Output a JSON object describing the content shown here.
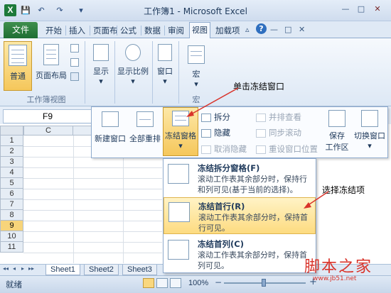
{
  "window": {
    "title": "工作簿1 - Microsoft Excel",
    "app_icon": "X",
    "minimize": "—",
    "restore": "□",
    "close": "✕",
    "ribbon_minimize": "▵",
    "help": "?",
    "doc_minimize": "—",
    "doc_restore": "□",
    "doc_close": "✕"
  },
  "quick_access": {
    "save": "💾",
    "undo": "↶",
    "redo": "↷",
    "customize": "▾"
  },
  "tabs": [
    "文件",
    "开始",
    "插入",
    "页面布",
    "公式",
    "数据",
    "审阅",
    "视图",
    "加载项"
  ],
  "active_tab": "视图",
  "ribbon": {
    "workbook_views_group": {
      "label": "工作簿视图",
      "normal": "普通",
      "page_layout": "页面布局"
    },
    "show_label": "显示",
    "zoom_label": "显示比例",
    "window_label": "窗口",
    "macros_label": "宏",
    "macros_group_label": "宏"
  },
  "formula_bar": {
    "name_box": "F9"
  },
  "grid": {
    "column_header": "C",
    "rows": [
      "1",
      "2",
      "3",
      "4",
      "5",
      "6",
      "7",
      "8",
      "9",
      "10",
      "11"
    ],
    "selected_row": "9"
  },
  "window_panel": {
    "new_window": "新建窗口",
    "arrange_all": "全部重排",
    "freeze_panes": "冻结窗格",
    "split": "拆分",
    "hide": "隐藏",
    "unhide": "取消隐藏",
    "view_side_by_side": "并排查看",
    "sync_scroll": "同步滚动",
    "reset_position": "重设窗口位置",
    "save_workspace_line1": "保存",
    "save_workspace_line2": "工作区",
    "switch_windows_line1": "切换窗口",
    "dropdown_arrow": "▾"
  },
  "freeze_menu": {
    "items": [
      {
        "title": "冻结拆分窗格(F)",
        "desc": "滚动工作表其余部分时，保持行和列可见(基于当前的选择)。"
      },
      {
        "title": "冻结首行(R)",
        "desc": "滚动工作表其余部分时，保持首行可见。"
      },
      {
        "title": "冻结首列(C)",
        "desc": "滚动工作表其余部分时，保持首列可见。"
      }
    ]
  },
  "sheet_tabs": [
    "Sheet1",
    "Sheet2",
    "Sheet3"
  ],
  "sheet_nav": [
    "◂◂",
    "◂",
    "▸",
    "▸▸"
  ],
  "status_bar": {
    "ready": "就绪",
    "zoom": "100%",
    "zoom_out": "−",
    "zoom_in": "+"
  },
  "annotations": {
    "click_freeze": "单击冻结窗口",
    "choose_freeze": "选择冻结项",
    "watermark": "脚本之家",
    "watermark_sub": "www.jb51.net"
  },
  "colors": {
    "file_tab": "#1f6e33",
    "highlight": "#fddb80",
    "arrow": "#d9342b"
  }
}
